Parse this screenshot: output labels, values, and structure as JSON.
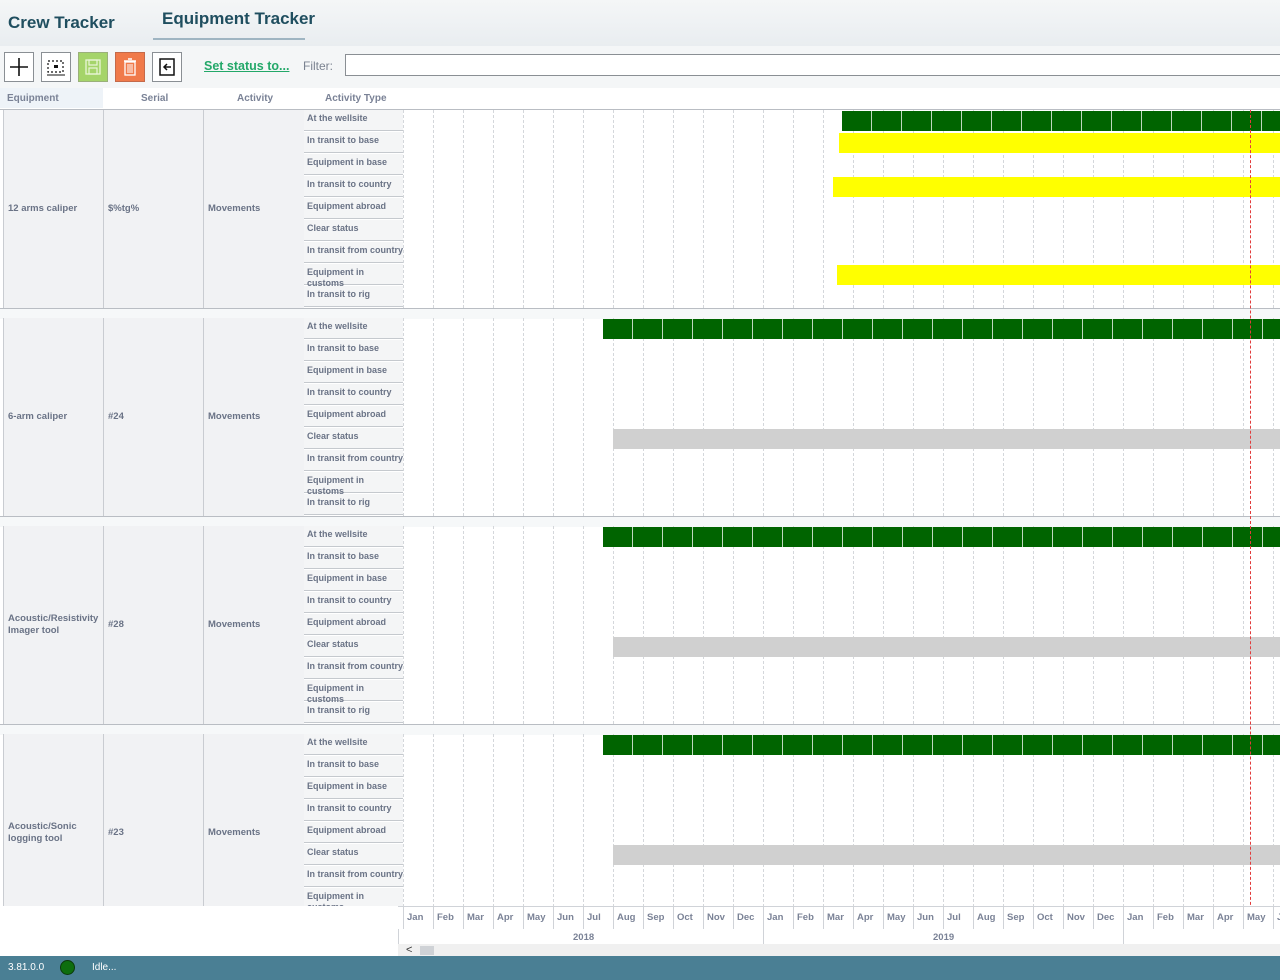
{
  "tabs": [
    {
      "label": "Crew Tracker",
      "active": false
    },
    {
      "label": "Equipment Tracker",
      "active": true
    }
  ],
  "toolbar": {
    "buttons": [
      {
        "name": "add-button",
        "icon": "plus-icon"
      },
      {
        "name": "select-button",
        "icon": "selection-icon"
      },
      {
        "name": "save-button",
        "icon": "floppy-icon",
        "color": "#a5d46a"
      },
      {
        "name": "delete-button",
        "icon": "trash-icon",
        "color": "#f07a4a"
      },
      {
        "name": "export-button",
        "icon": "exit-icon"
      }
    ],
    "set_status_label": "Set status to...",
    "filter_label": "Filter:",
    "filter_value": ""
  },
  "columns": {
    "equipment": "Equipment",
    "serial": "Serial",
    "activity": "Activity",
    "activity_type": "Activity Type"
  },
  "activity_types": [
    "At the wellsite",
    "In transit to base",
    "Equipment in base",
    "In transit to country",
    "Equipment abroad",
    "Clear status",
    "In transit from country",
    "Equipment in customs",
    "In transit to rig"
  ],
  "rows": [
    {
      "equipment": "12 arms caliper",
      "serial": "$%tg%",
      "activity": "Movements",
      "bars": [
        {
          "type_index": 0,
          "color": "green",
          "start": "2019-03-20"
        },
        {
          "type_index": 1,
          "color": "yellow",
          "start": "2019-03-17"
        },
        {
          "type_index": 3,
          "color": "yellow",
          "start": "2019-03-11"
        },
        {
          "type_index": 7,
          "color": "yellow",
          "start": "2019-03-15"
        }
      ]
    },
    {
      "equipment": "6-arm caliper",
      "serial": "#24",
      "activity": "Movements",
      "bars": [
        {
          "type_index": 0,
          "color": "green",
          "start": "2018-07-21"
        },
        {
          "type_index": 5,
          "color": "gray",
          "start": "2018-08-01"
        }
      ]
    },
    {
      "equipment": "Acoustic/Resistivity Imager tool",
      "serial": "#28",
      "activity": "Movements",
      "bars": [
        {
          "type_index": 0,
          "color": "green",
          "start": "2018-07-21"
        },
        {
          "type_index": 5,
          "color": "gray",
          "start": "2018-08-01"
        }
      ]
    },
    {
      "equipment": "Acoustic/Sonic logging tool",
      "serial": "#23",
      "activity": "Movements",
      "bars": [
        {
          "type_index": 0,
          "color": "green",
          "start": "2018-07-21"
        },
        {
          "type_index": 5,
          "color": "gray",
          "start": "2018-08-01"
        }
      ]
    }
  ],
  "timeline": {
    "months": [
      "Jan",
      "Feb",
      "Mar",
      "Apr",
      "May",
      "Jun",
      "Jul",
      "Aug",
      "Sep",
      "Oct",
      "Nov",
      "Dec",
      "Jan",
      "Feb",
      "Mar",
      "Apr",
      "May",
      "Jun",
      "Jul",
      "Aug",
      "Sep",
      "Oct",
      "Nov",
      "Dec",
      "Jan",
      "Feb",
      "Mar",
      "Apr",
      "May",
      "Ju"
    ],
    "years": [
      "2018",
      "2019"
    ],
    "today": "2020-05-01"
  },
  "status": {
    "version": "3.81.0.0",
    "text": "Idle..."
  },
  "colors": {
    "green": "#006400",
    "yellow": "#ffff00",
    "gray": "#d0d0d0",
    "today_line": "#e23b3b"
  }
}
